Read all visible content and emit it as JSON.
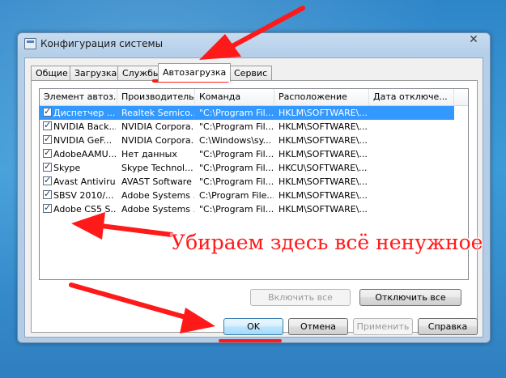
{
  "window": {
    "title": "Конфигурация системы",
    "close_glyph": "✕"
  },
  "tabs": [
    {
      "label": "Общие"
    },
    {
      "label": "Загрузка"
    },
    {
      "label": "Службы"
    },
    {
      "label": "Автозагрузка"
    },
    {
      "label": "Сервис"
    }
  ],
  "active_tab": "Автозагрузка",
  "startup_table": {
    "columns": [
      "Элемент автоз...",
      "Производитель",
      "Команда",
      "Расположение",
      "Дата отключе..."
    ],
    "rows": [
      {
        "checked": true,
        "selected": true,
        "item": "Диспетчер ...",
        "maker": "Realtek Semico...",
        "command": "\"C:\\Program Fil...",
        "location": "HKLM\\SOFTWARE\\...",
        "date": ""
      },
      {
        "checked": true,
        "selected": false,
        "item": "NVIDIA Back...",
        "maker": "NVIDIA Corpora...",
        "command": "\"C:\\Program Fil...",
        "location": "HKLM\\SOFTWARE\\...",
        "date": ""
      },
      {
        "checked": true,
        "selected": false,
        "item": "NVIDIA GeF...",
        "maker": "NVIDIA Corpora...",
        "command": "C:\\Windows\\sy...",
        "location": "HKLM\\SOFTWARE\\...",
        "date": ""
      },
      {
        "checked": true,
        "selected": false,
        "item": "AdobeAAMU...",
        "maker": "Нет данных",
        "command": "\"C:\\Program Fil...",
        "location": "HKLM\\SOFTWARE\\...",
        "date": ""
      },
      {
        "checked": true,
        "selected": false,
        "item": "Skype",
        "maker": "Skype Technol...",
        "command": "\"C:\\Program Fil...",
        "location": "HKCU\\SOFTWARE\\...",
        "date": ""
      },
      {
        "checked": true,
        "selected": false,
        "item": "Avast Antivirus",
        "maker": "AVAST Software",
        "command": "\"C:\\Program Fil...",
        "location": "HKLM\\SOFTWARE\\...",
        "date": ""
      },
      {
        "checked": true,
        "selected": false,
        "item": "SBSV 2010/...",
        "maker": "Adobe Systems ...",
        "command": "C:\\Program File...",
        "location": "HKLM\\SOFTWARE\\...",
        "date": ""
      },
      {
        "checked": true,
        "selected": false,
        "item": "Adobe CS5 S...",
        "maker": "Adobe Systems ...",
        "command": "\"C:\\Program Fil...",
        "location": "HKLM\\SOFTWARE\\...",
        "date": ""
      }
    ]
  },
  "panel_buttons": {
    "enable_all": "Включить все",
    "disable_all": "Отключить все"
  },
  "dialog_buttons": {
    "ok": "OK",
    "cancel": "Отмена",
    "apply": "Применить",
    "help": "Справка"
  },
  "annotation": {
    "text": "Убираем здесь всё ненужное",
    "color": "#ff1a1a"
  },
  "colors": {
    "selection": "#3399ff",
    "annotation_red": "#ff1a1a"
  }
}
